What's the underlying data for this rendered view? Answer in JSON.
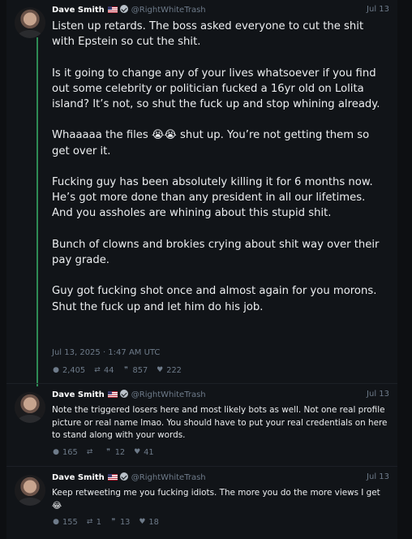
{
  "tweets": [
    {
      "name": "Dave Smith",
      "handle": "@RightWhiteTrash",
      "date": "Jul 13",
      "text": "Listen up retards. The boss asked everyone to cut the shit with Epstein so cut the shit.\n\nIs it going to change any of your lives whatsoever if you find out some celebrity or politician fucked a 16yr old on Lolita island? It’s not, so shut the fuck up and stop whining already.\n\nWhaaaaa the files 😭😭 shut up. You’re not getting them so get over it.\n\nFucking guy has been absolutely killing it for 6 months now. He’s got more done than any president in all our lifetimes. And you assholes are whining about this stupid shit.\n\nBunch of clowns and brokies crying about shit way over their pay grade.\n\nGuy got fucking shot once and almost again for you morons. Shut the fuck up and let him do his job.",
      "timestamp": "Jul 13, 2025 · 1:47 AM UTC",
      "stats": {
        "replies": "2,405",
        "retweets": "44",
        "quotes": "857",
        "likes": "222"
      }
    },
    {
      "name": "Dave Smith",
      "handle": "@RightWhiteTrash",
      "date": "Jul 13",
      "text": "Note the triggered losers here and most likely bots as well. Not one real profile picture or real name lmao. You should have to put your real credentials on here to stand along with your words.",
      "stats": {
        "replies": "165",
        "retweets": "",
        "quotes": "12",
        "likes": "41"
      }
    },
    {
      "name": "Dave Smith",
      "handle": "@RightWhiteTrash",
      "date": "Jul 13",
      "text": "Keep retweeting me you fucking idiots. The more you do the more views I get 😂",
      "stats": {
        "replies": "155",
        "retweets": "1",
        "quotes": "13",
        "likes": "18"
      }
    }
  ],
  "icons": {
    "reply": "comment-icon",
    "retweet": "retweet-icon",
    "quote": "quote-icon",
    "like": "heart-icon"
  }
}
